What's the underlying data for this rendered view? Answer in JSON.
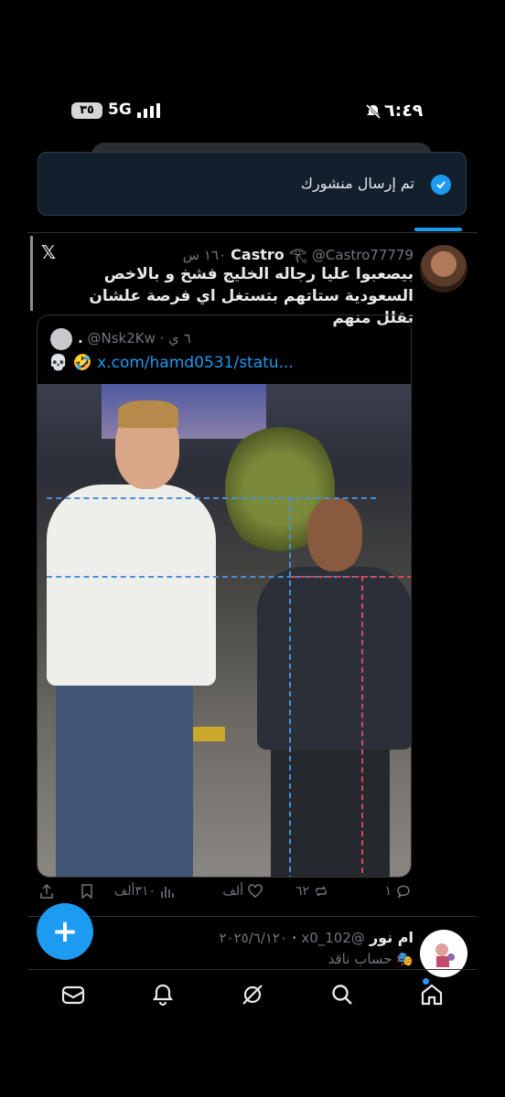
{
  "status_bar": {
    "time": "٦:٤٩",
    "network": "5G",
    "battery": "٣٥"
  },
  "toast": {
    "message": "تم إرسال منشورك"
  },
  "post": {
    "name": "Castro",
    "handle": "@Castro77779",
    "time": "١٦٠ س",
    "text": "بيصعبوا عليا رجاله الخليج فشخ و بالاخص السعودية ستاتهم بتستغل اي فرصة علشان تقلل منهم",
    "quoted": {
      "name": ".",
      "handle": "@Nsk2Kw",
      "time": "٦ ي",
      "emoji": "💀 🤣",
      "link": "x.com/hamd0531/statu..."
    },
    "actions": {
      "replies": "١",
      "reposts": "٦٢",
      "likes": "ألف",
      "views": "٣١٠ألف"
    }
  },
  "next_post": {
    "name": "ام نور",
    "handle": "@x0_102",
    "date": "٢٠٢٥/٦/١٢٠",
    "subtitle": "🎭 حساب ناقد"
  },
  "nav": {
    "items": [
      "home-icon",
      "search-icon",
      "grok-icon",
      "notifications-icon",
      "messages-icon"
    ]
  },
  "colors": {
    "accent": "#1d9bf0",
    "background": "#000000"
  }
}
